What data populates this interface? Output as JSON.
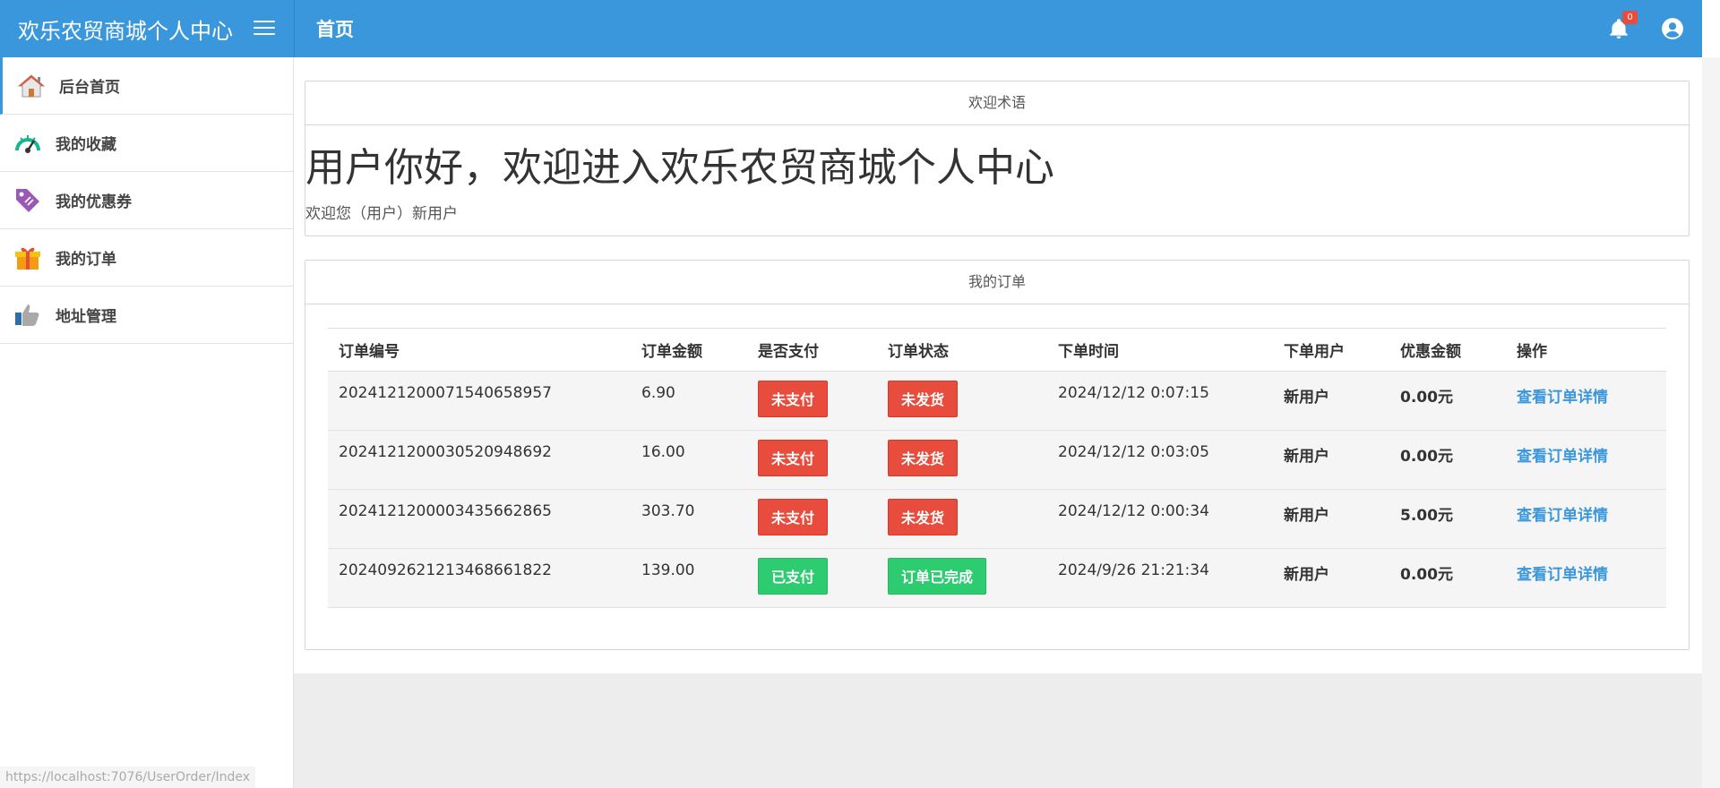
{
  "app": {
    "title": "欢乐农贸商城个人中心",
    "page_title": "首页",
    "notification_count": "0",
    "status_url": "https://localhost:7076/UserOrder/Index"
  },
  "colors": {
    "primary": "#3a97dc",
    "danger": "#e74c3c",
    "success": "#2ecc71"
  },
  "sidebar": {
    "items": [
      {
        "label": "后台首页",
        "icon": "home-icon"
      },
      {
        "label": "我的收藏",
        "icon": "dashboard-gauge-icon"
      },
      {
        "label": "我的优惠券",
        "icon": "price-tag-icon"
      },
      {
        "label": "我的订单",
        "icon": "gift-box-icon"
      },
      {
        "label": "地址管理",
        "icon": "thumbs-up-icon"
      }
    ]
  },
  "welcome": {
    "header": "欢迎术语",
    "title": "用户你好，欢迎进入欢乐农贸商城个人中心",
    "subtitle": "欢迎您（用户）新用户"
  },
  "orders": {
    "header": "我的订单",
    "columns": [
      "订单编号",
      "订单金额",
      "是否支付",
      "订单状态",
      "下单时间",
      "下单用户",
      "优惠金额",
      "操作"
    ],
    "rows": [
      {
        "id": "20241212000715406589 57",
        "amount": "6.90",
        "paid": "未支付",
        "paid_status": "unpaid",
        "state": "未发货",
        "state_status": "pending",
        "time": "2024/12/12 0:07:15",
        "user": "新用户",
        "discount": "0.00元",
        "action": "查看订单详情"
      },
      {
        "id": "2024121200030520948692",
        "amount": "16.00",
        "paid": "未支付",
        "paid_status": "unpaid",
        "state": "未发货",
        "state_status": "pending",
        "time": "2024/12/12 0:03:05",
        "user": "新用户",
        "discount": "0.00元",
        "action": "查看订单详情"
      },
      {
        "id": "2024121200003435662865",
        "amount": "303.70",
        "paid": "未支付",
        "paid_status": "unpaid",
        "state": "未发货",
        "state_status": "pending",
        "time": "2024/12/12 0:00:34",
        "user": "新用户",
        "discount": "5.00元",
        "action": "查看订单详情"
      },
      {
        "id": "2024092621213468661822",
        "amount": "139.00",
        "paid": "已支付",
        "paid_status": "paid",
        "state": "订单已完成",
        "state_status": "done",
        "time": "2024/9/26 21:21:34",
        "user": "新用户",
        "discount": "0.00元",
        "action": "查看订单详情"
      }
    ]
  }
}
